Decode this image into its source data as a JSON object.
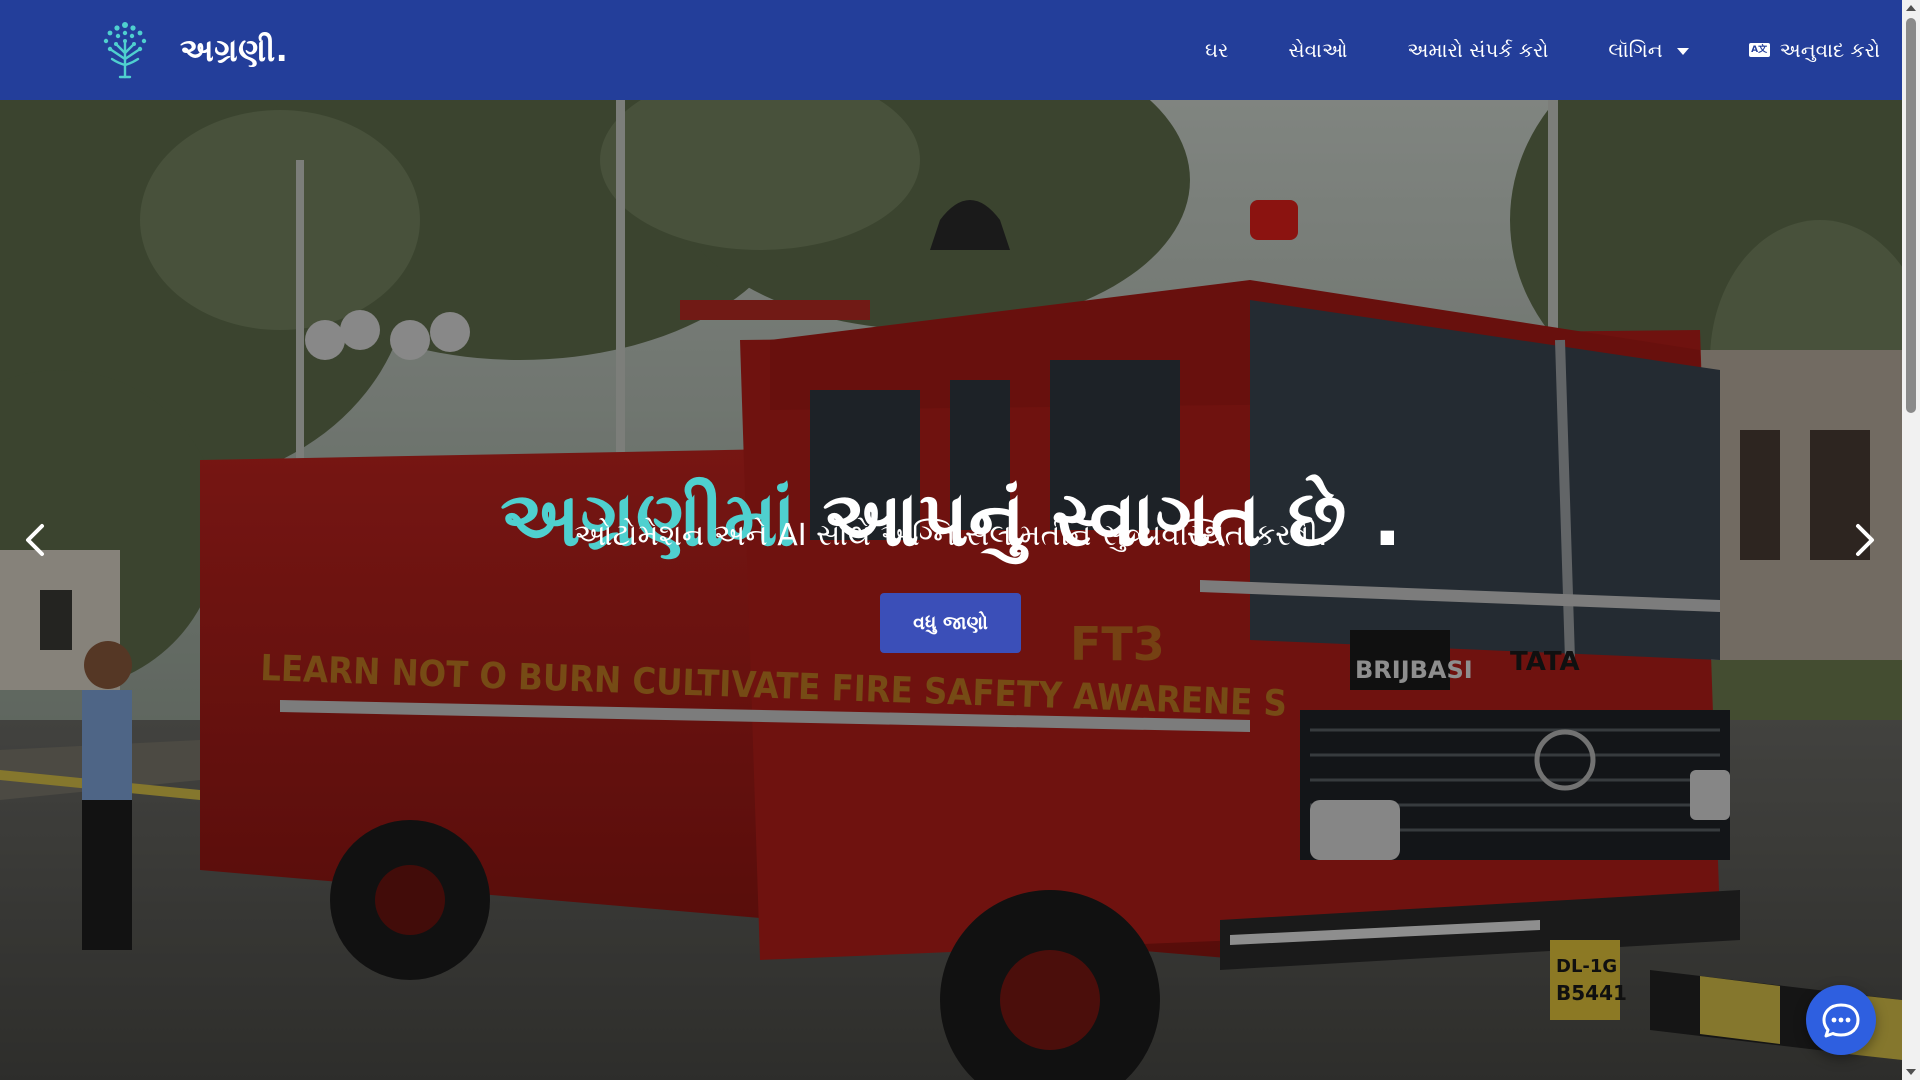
{
  "brand": {
    "name": "અગ્રણી."
  },
  "nav": {
    "items": [
      {
        "label": "ઘર"
      },
      {
        "label": "સેવાઓ"
      },
      {
        "label": "અમારો સંપર્ક કરો"
      },
      {
        "label": "લૉગિન"
      }
    ],
    "translate_label": "અનુવાદ કરો",
    "translate_icon": "translate-icon",
    "dropdown_icon": "caret-down-icon"
  },
  "hero": {
    "title_accent": "અગ્રણીમાં",
    "title_rest": " આપનું સ્વાગત છે .",
    "subtitle": "ઓટોમેશન અને AI સાથે અગ્નિ સલામતીને સુવ્યવસ્થિત કરવી.",
    "button_label": "વધુ જાણો",
    "truck_lettering_side": "LEARN NOT O BURN  CULTIVATE FIRE SAFETY AWARENE S",
    "truck_brand": "TATA",
    "truck_grille_badge": "BRIJBASI",
    "truck_plate": "DL-1G B5441",
    "truck_code": "FT3"
  },
  "colors": {
    "navbar_bg": "#233e9a",
    "accent_teal": "#4fd0cf",
    "button_bg": "#3b4fb8",
    "chat_bg": "#2e5fe0"
  },
  "icons": {
    "carousel_prev": "chevron-left-icon",
    "carousel_next": "chevron-right-icon",
    "chat": "chat-bubble-icon"
  }
}
